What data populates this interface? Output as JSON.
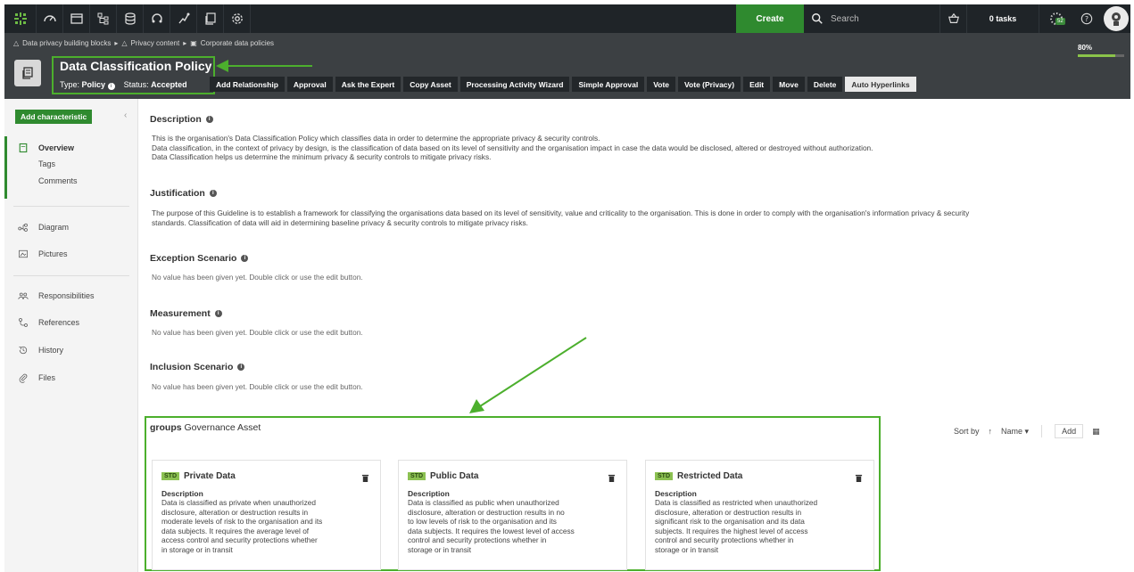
{
  "topnav": {
    "create_label": "Create",
    "search_placeholder": "Search",
    "tasks_label": "0 tasks",
    "spinner_badge": "52"
  },
  "header": {
    "breadcrumb": [
      "Data privacy building blocks",
      "Privacy content",
      "Corporate data policies"
    ],
    "progress_label": "80%",
    "progress_value": 0.8,
    "title": "Data Classification Policy",
    "type_label": "Type:",
    "type_value": "Policy",
    "status_label": "Status:",
    "status_value": "Accepted",
    "actions": [
      "Add Relationship",
      "Approval",
      "Ask the Expert",
      "Copy Asset",
      "Processing Activity Wizard",
      "Simple Approval",
      "Vote",
      "Vote (Privacy)",
      "Edit",
      "Move",
      "Delete",
      "Auto Hyperlinks"
    ]
  },
  "sidebar": {
    "add_characteristic": "Add characteristic",
    "overview": "Overview",
    "tags": "Tags",
    "comments": "Comments",
    "diagram": "Diagram",
    "pictures": "Pictures",
    "responsibilities": "Responsibilities",
    "references": "References",
    "history": "History",
    "files": "Files"
  },
  "main": {
    "description_title": "Description",
    "description_lines": [
      "This is the organisation's Data Classification Policy which classifies data in order to determine the appropriate privacy & security controls.",
      "Data classification, in the context of privacy by design, is the classification of data based on its level of sensitivity and the organisation impact in case the data would be disclosed, altered or destroyed without authorization.",
      "Data Classification helps us determine the minimum privacy & security controls to mitigate privacy risks."
    ],
    "justification_title": "Justification",
    "justification_lines": [
      "The purpose of this Guideline is to establish a framework for classifying the organisations data based on its level of sensitivity, value and criticality to the organisation. This is done in order to comply with the organisation's information privacy & security",
      "standards. Classification of data will aid in determining baseline privacy & security controls to mitigate privacy risks."
    ],
    "exception_title": "Exception Scenario",
    "measurement_title": "Measurement",
    "inclusion_title": "Inclusion Scenario",
    "empty_text": "No value has been given yet. Double click or use the edit button."
  },
  "group": {
    "prefix": "groups",
    "title": "Governance Asset",
    "sort_by": "Sort by",
    "sort_field": "Name",
    "add": "Add",
    "cards": [
      {
        "badge": "STD",
        "name": "Private Data",
        "desc_label": "Description",
        "lines": [
          "Data is classified as private when unauthorized",
          "disclosure, alteration or destruction results in",
          "moderate levels of risk to the organisation and its",
          "data subjects. It requires the average level of",
          "access control and security protections whether",
          "in storage or in transit"
        ]
      },
      {
        "badge": "STD",
        "name": "Public Data",
        "desc_label": "Description",
        "lines": [
          "Data is classified as public when unauthorized",
          "disclosure, alteration or destruction results in no",
          "to low levels of risk to the organisation and its",
          "data subjects. It requires the lowest level of access",
          "control and security protections whether  in",
          "storage or in transit"
        ]
      },
      {
        "badge": "STD",
        "name": "Restricted Data",
        "desc_label": "Description",
        "lines": [
          "Data is classified as restricted when unauthorized",
          "disclosure, alteration or destruction results in",
          "significant risk to the organisation and its data",
          "subjects. It requires the highest level of access",
          "control and security protections whether  in",
          "storage or in transit"
        ]
      }
    ]
  },
  "colors": {
    "accent_green": "#2f8a2f",
    "annotation_green": "#4caf2d",
    "nav_dark": "#1f2428",
    "header_dark": "#3c4043"
  }
}
